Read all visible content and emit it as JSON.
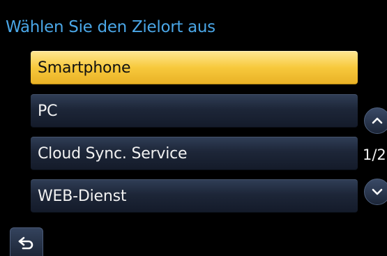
{
  "title": "Wählen Sie den Zielort aus",
  "menu": {
    "items": [
      {
        "label": "Smartphone",
        "selected": true
      },
      {
        "label": "PC",
        "selected": false
      },
      {
        "label": "Cloud Sync. Service",
        "selected": false
      },
      {
        "label": "WEB-Dienst",
        "selected": false
      }
    ]
  },
  "pagination": {
    "indicator": "1/2",
    "up_icon": "chevron-up-icon",
    "down_icon": "chevron-down-icon"
  },
  "back": {
    "icon": "return-arrow-icon"
  },
  "colors": {
    "title": "#4aa6e6",
    "selected_item": "#f7c93c",
    "item_background": "#1d2638",
    "background": "#000000"
  }
}
